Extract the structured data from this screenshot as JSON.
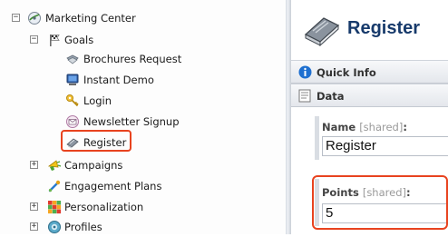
{
  "tree": {
    "root": {
      "label": "Marketing Center",
      "expander": "−",
      "icon": "marketing-center-icon"
    },
    "goals": {
      "label": "Goals",
      "expander": "−",
      "icon": "flag-icon"
    },
    "goal_items": [
      {
        "label": "Brochures Request",
        "icon": "brochures-icon"
      },
      {
        "label": "Instant Demo",
        "icon": "monitor-icon"
      },
      {
        "label": "Login",
        "icon": "key-icon"
      },
      {
        "label": "Newsletter Signup",
        "icon": "envelope-icon"
      },
      {
        "label": "Register",
        "icon": "register-book-icon",
        "selected": true
      }
    ],
    "others": [
      {
        "label": "Campaigns",
        "expander": "+",
        "icon": "campaigns-icon"
      },
      {
        "label": "Engagement Plans",
        "expander": "",
        "icon": "engagement-plans-icon"
      },
      {
        "label": "Personalization",
        "expander": "+",
        "icon": "personalization-icon"
      },
      {
        "label": "Profiles",
        "expander": "+",
        "icon": "profiles-icon"
      }
    ]
  },
  "editor": {
    "title": "Register",
    "title_icon": "register-book-icon",
    "sections": {
      "quick_info": "Quick Info",
      "data": "Data"
    },
    "fields": {
      "name": {
        "label": "Name",
        "shared": "[shared]",
        "colon": ":",
        "value": "Register"
      },
      "points": {
        "label": "Points",
        "shared": "[shared]",
        "colon": ":",
        "value": "5"
      }
    }
  },
  "colors": {
    "highlight": "#e8431f",
    "title": "#173a6b",
    "info_blue": "#1e6fd0"
  }
}
